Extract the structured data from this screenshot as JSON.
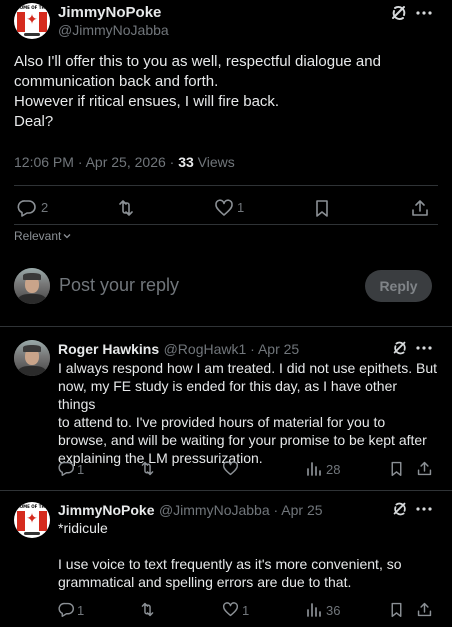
{
  "main_tweet": {
    "avatar_caption": "HOME OF THE",
    "author_name": "JimmyNoPoke",
    "author_handle": "@JimmyNoJabba",
    "text_lines": [
      "Also I'll offer this to you as well, respectful dialogue and",
      "communication back and forth.",
      "However if ritical ensues, I will fire back.",
      "Deal?"
    ],
    "timestamp": "12:06 PM · Apr 25, 2026 · ",
    "views_count": "33",
    "views_label": " Views",
    "replies": "2",
    "reposts": "",
    "likes": "1"
  },
  "sort": {
    "label": "Relevant"
  },
  "composer": {
    "placeholder": "Post your reply",
    "reply_label": "Reply"
  },
  "replies": [
    {
      "author_name": "Roger Hawkins",
      "author_handle": "@RogHawk1",
      "date": " · Apr 25",
      "text_lines": [
        "I always respond how I am treated. I did not use epithets. But",
        "now, my FE study is ended for this day, as I have other things",
        "to attend to. I've provided hours of material for you to",
        "browse, and will be waiting for your promise to be kept after",
        "explaining the LM pressurization."
      ],
      "replies": "1",
      "reposts": "",
      "likes": "",
      "views": "28"
    },
    {
      "author_name": "JimmyNoPoke",
      "author_handle": "@JimmyNoJabba",
      "date": " · Apr 25",
      "text_lines": [
        "*ridicule",
        "",
        "I use voice to text frequently as it's more convenient, so",
        "grammatical and spelling errors are due to that."
      ],
      "replies": "1",
      "reposts": "",
      "likes": "1",
      "views": "36"
    }
  ],
  "colors": {
    "background": "#000000",
    "text": "#e7e9ea",
    "muted": "#71767b",
    "divider": "#2f3336",
    "reply_button_bg": "#3a3d40"
  },
  "icons": [
    "grok-icon",
    "more-icon",
    "reply-icon",
    "repost-icon",
    "like-icon",
    "bookmark-icon",
    "share-icon",
    "views-icon",
    "chevron-down-icon"
  ]
}
